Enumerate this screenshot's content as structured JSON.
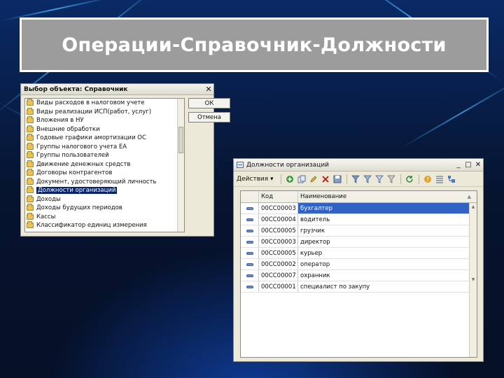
{
  "slide_title": "Операции-Справочник-Должности",
  "dialog": {
    "title": "Выбор объекта: Справочник",
    "close": "✕",
    "items": [
      "Виды расходов в налоговом учете",
      "Виды реализации ИСП(работ, услуг)",
      "Вложения в НУ",
      "Внешние обработки",
      "Годовые графики амортизации ОС",
      "Группы налогового учета ЕА",
      "Группы пользователей",
      "Движение денежных средств",
      "Договоры контрагентов",
      "Документ, удостоверяющий личность",
      "Должности организаций",
      "Доходы",
      "Доходы будущих периодов",
      "Кассы",
      "Классификатор единиц измерения"
    ],
    "selected_index": 10,
    "ok_label": "ОК",
    "cancel_label": "Отмена"
  },
  "window": {
    "title": "Должности организаций",
    "controls": [
      "_",
      "□",
      "✕"
    ],
    "actions_label": "Действия ▾",
    "columns": {
      "code": "Код",
      "name": "Наименование",
      "sort_icon": "▲"
    },
    "rows": [
      {
        "code": "00СС00003",
        "name": "бухгалтер"
      },
      {
        "code": "00СС00004",
        "name": "водитель"
      },
      {
        "code": "00СС00005",
        "name": "грузчик"
      },
      {
        "code": "00СС00003",
        "name": "директор"
      },
      {
        "code": "00СС00005",
        "name": "курьер"
      },
      {
        "code": "00СС00002",
        "name": "оператор"
      },
      {
        "code": "00СС00007",
        "name": "охранник"
      },
      {
        "code": "00СС00001",
        "name": "специалист по закупу"
      }
    ],
    "selected_row": 0
  },
  "colors": {
    "slide_bg": "#07163a",
    "title_box": "#9c9c9c",
    "selection": "#3163c5",
    "tree_selection": "#0a246a"
  }
}
